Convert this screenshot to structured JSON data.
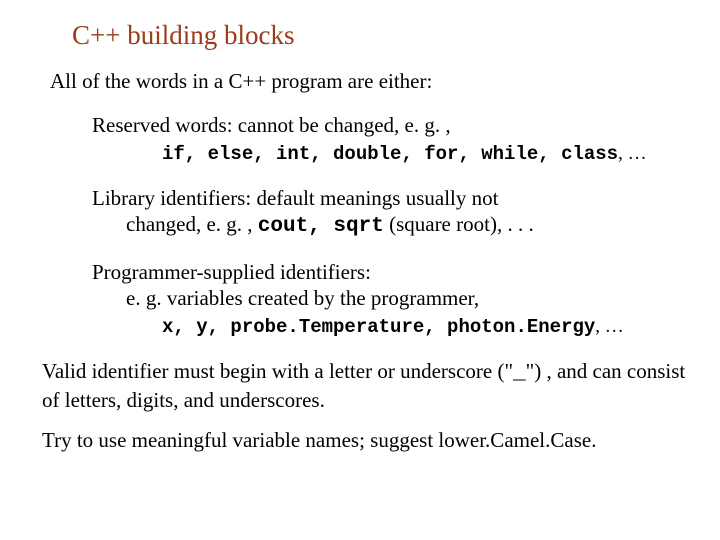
{
  "title": "C++ building blocks",
  "intro": "All of the words in a C++ program are either:",
  "reserved": {
    "lead": "Reserved words:  cannot be changed, e. g. ,",
    "code": "if, else, int, double, for, while, class",
    "tail": ", …"
  },
  "library": {
    "lead": "Library identifiers:  default meanings usually not",
    "sub_prefix": "changed, e. g. , ",
    "code": "cout, sqrt",
    "sub_suffix": " (square root), . . ."
  },
  "programmer": {
    "lead": "Programmer-supplied identifiers:",
    "sub": "e. g. variables created by the programmer,",
    "code": "x, y, probe.Temperature, photon.Energy",
    "tail": ", …"
  },
  "valid": {
    "part1": "Valid identifier must begin with a letter or underscore (\"",
    "underscore": "_",
    "part2": "\") , and can consist of letters, digits, and underscores."
  },
  "closing": "Try to use meaningful variable names; suggest lower.Camel.Case."
}
